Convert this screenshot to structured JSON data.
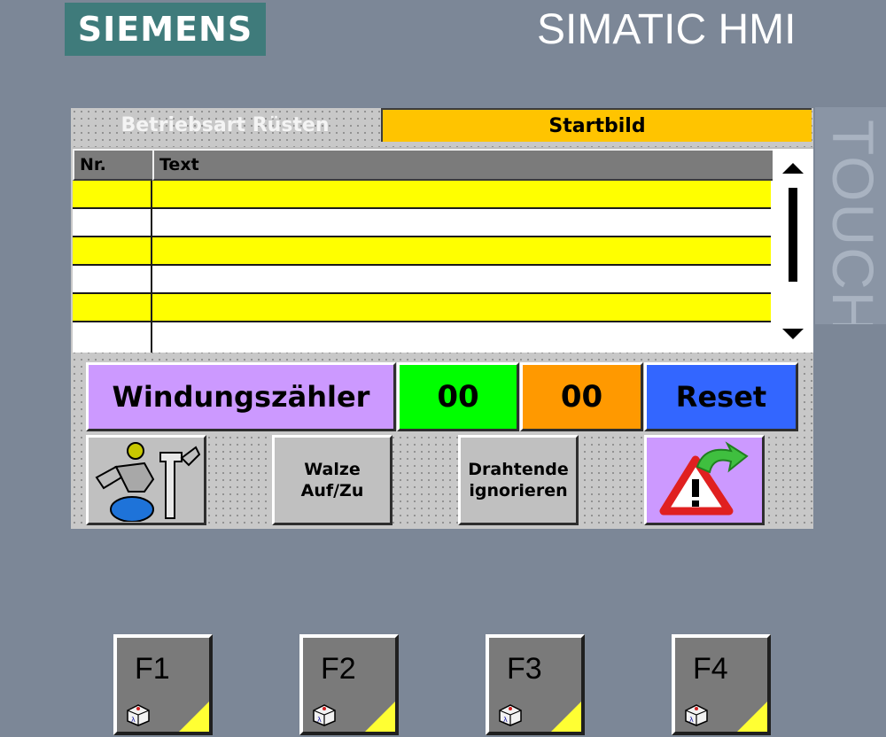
{
  "brand": {
    "logo_text": "SIEMENS",
    "product": "SIMATIC HMI",
    "side_label": "TOUCH"
  },
  "screen": {
    "mode_label": "Betriebsart Rüsten",
    "title": "Startbild",
    "alarm_list": {
      "columns": [
        "Nr.",
        "Text"
      ],
      "rows": [
        {
          "nr": "",
          "text": ""
        },
        {
          "nr": "",
          "text": ""
        },
        {
          "nr": "",
          "text": ""
        },
        {
          "nr": "",
          "text": ""
        },
        {
          "nr": "",
          "text": ""
        },
        {
          "nr": "",
          "text": ""
        }
      ]
    },
    "counter": {
      "label": "Windungszähler",
      "value_1": "00",
      "value_2": "00",
      "reset_label": "Reset"
    },
    "buttons": {
      "walze_line1": "Walze",
      "walze_line2": "Auf/Zu",
      "draht_line1": "Drahtende",
      "draht_line2": "ignorieren"
    }
  },
  "function_keys": [
    "F1",
    "F2",
    "F3",
    "F4"
  ],
  "colors": {
    "frame": "#7c8797",
    "logo_bg": "#3f7b7b",
    "title_bar": "#ffc400",
    "row_highlight": "#ffff00",
    "counter_label": "#cc99ff",
    "counter_1": "#00ff00",
    "counter_2": "#ff9900",
    "reset": "#3366ff"
  },
  "icons": {
    "service": "service-technician-icon",
    "alarm": "alarm-acknowledge-icon",
    "fkey_device": "device-lambda-icon"
  }
}
